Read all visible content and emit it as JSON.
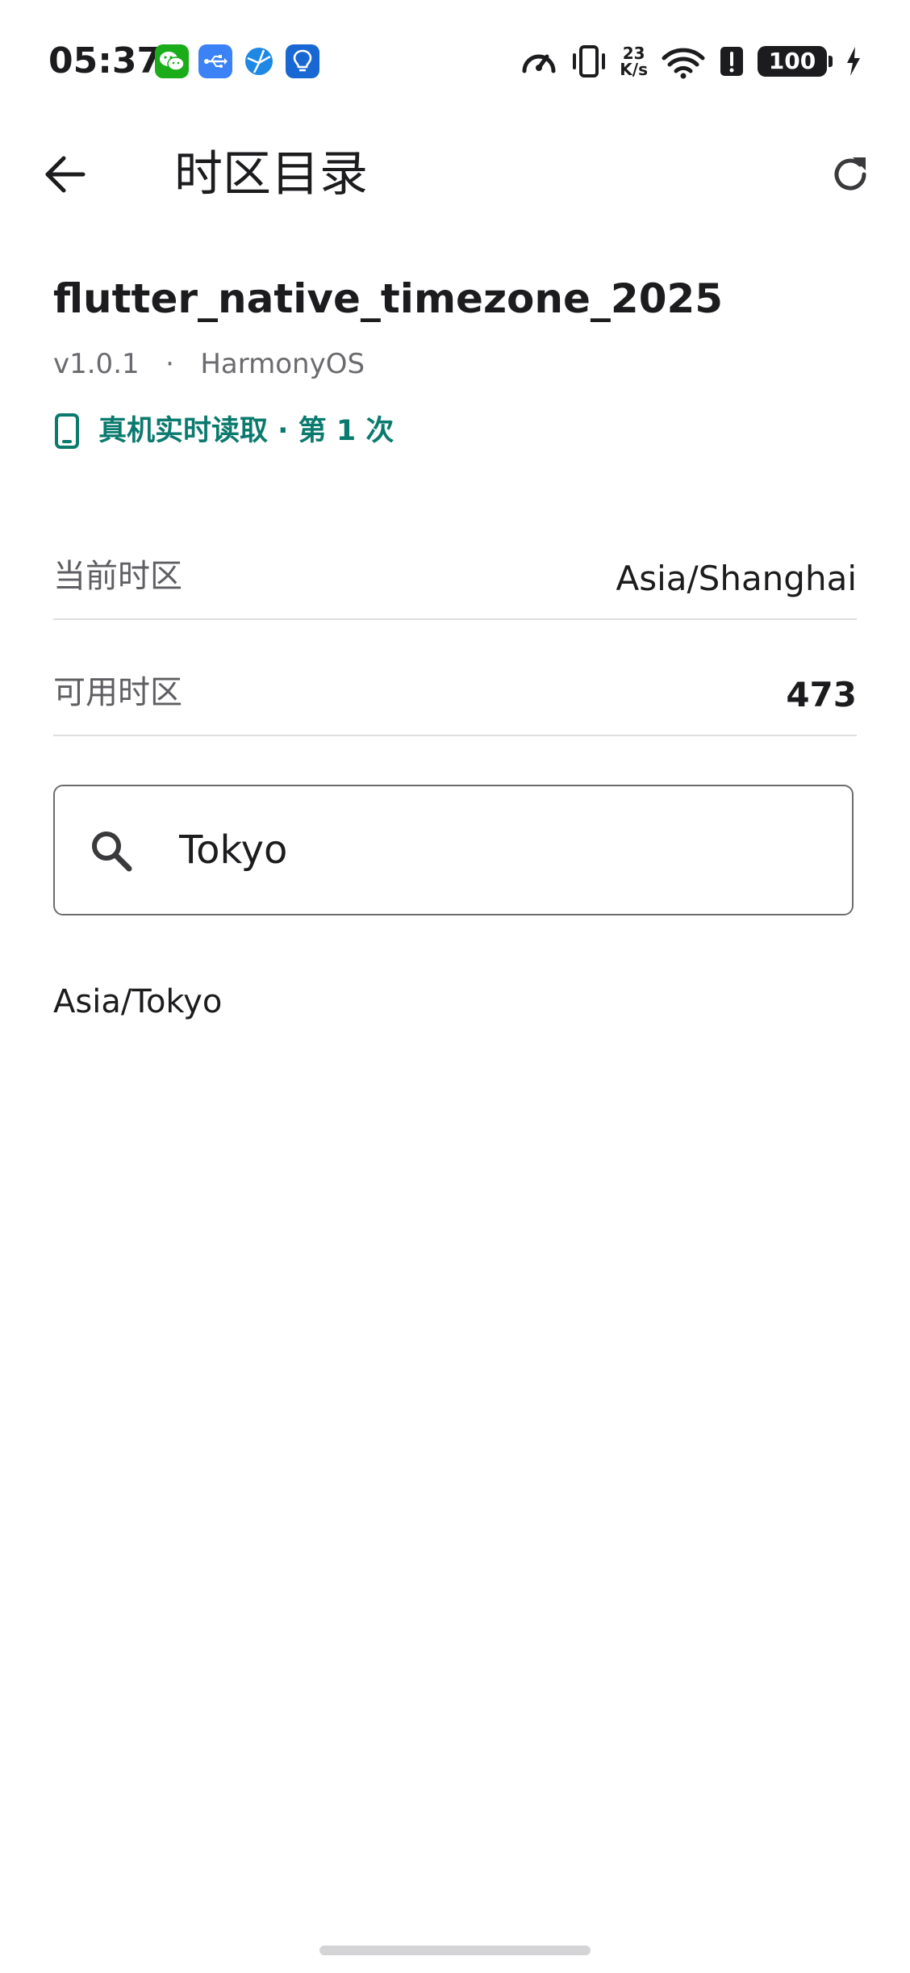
{
  "status_bar": {
    "time": "05:37",
    "net_speed_value": "23",
    "net_speed_unit": "K/s",
    "battery": "100",
    "notification_icons": [
      "wechat-icon",
      "usb-icon",
      "browser-icon",
      "lightbulb-icon"
    ],
    "system_icons": [
      "speedometer-icon",
      "vibrate-icon",
      "wifi-icon",
      "alert-icon",
      "battery-icon",
      "charging-icon"
    ]
  },
  "app_bar": {
    "title": "时区目录",
    "back_icon": "arrow-left-icon",
    "refresh_icon": "refresh-icon"
  },
  "package": {
    "name": "flutter_native_timezone_2025",
    "version": "v1.0.1",
    "separator": "·",
    "platform": "HarmonyOS",
    "device_read_status": "真机实时读取 · 第 1 次"
  },
  "info": {
    "current_label": "当前时区",
    "current_value": "Asia/Shanghai",
    "count_label": "可用时区",
    "count_value": "473"
  },
  "search": {
    "value": "Tokyo",
    "placeholder": ""
  },
  "results": [
    "Asia/Tokyo"
  ],
  "colors": {
    "accent": "#0b7a6e",
    "text_primary": "#1c1c1e",
    "text_secondary": "#6b6b6f",
    "divider": "#dedede",
    "wechat_green": "#1aad19"
  }
}
